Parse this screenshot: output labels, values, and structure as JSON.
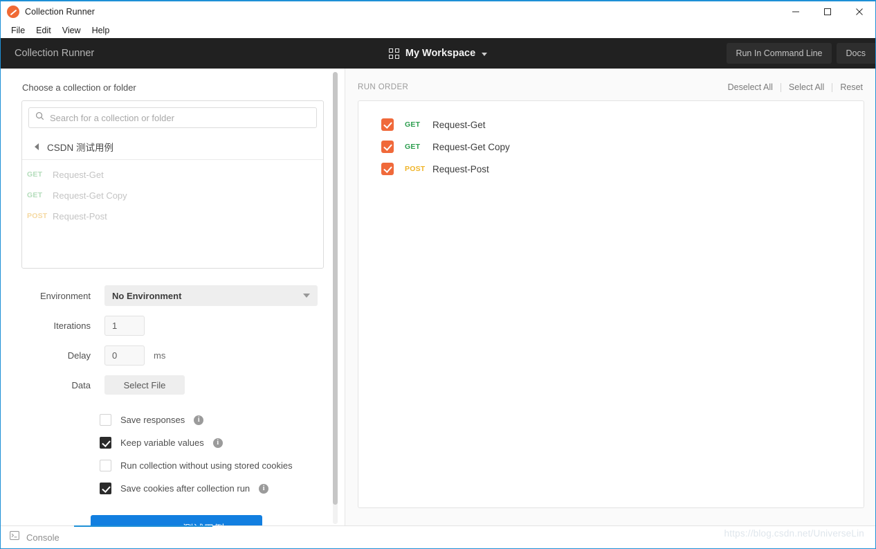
{
  "window": {
    "title": "Collection Runner",
    "logo_icon": "postman-logo-icon",
    "controls": {
      "minimize": "minimize-icon",
      "maximize": "maximize-icon",
      "close": "close-icon"
    }
  },
  "menubar": {
    "items": [
      {
        "label": "File"
      },
      {
        "label": "Edit"
      },
      {
        "label": "View"
      },
      {
        "label": "Help"
      }
    ]
  },
  "header": {
    "title": "Collection Runner",
    "workspace": {
      "icon": "grid-icon",
      "name": "My Workspace",
      "chevron": "chevron-down-icon"
    },
    "run_command_line_label": "Run In Command Line",
    "docs_label": "Docs",
    "background": "#212121"
  },
  "left": {
    "choose_label": "Choose a collection or folder",
    "search": {
      "icon": "search-icon",
      "placeholder": "Search for a collection or folder",
      "value": ""
    },
    "breadcrumb": {
      "back_icon": "back-triangle-icon",
      "name": "CSDN 测试用例"
    },
    "requests": [
      {
        "method": "GET",
        "name": "Request-Get"
      },
      {
        "method": "GET",
        "name": "Request-Get Copy"
      },
      {
        "method": "POST",
        "name": "Request-Post"
      }
    ],
    "form": {
      "environment_label": "Environment",
      "environment_value": "No Environment",
      "iterations_label": "Iterations",
      "iterations_value": "1",
      "delay_label": "Delay",
      "delay_value": "0",
      "delay_unit": "ms",
      "data_label": "Data",
      "select_file_label": "Select File"
    },
    "options": [
      {
        "label": "Save responses",
        "checked": false,
        "info": true
      },
      {
        "label": "Keep variable values",
        "checked": true,
        "info": true
      },
      {
        "label": "Run collection without using stored cookies",
        "checked": false,
        "info": false
      },
      {
        "label": "Save cookies after collection run",
        "checked": true,
        "info": true
      }
    ],
    "run_button_label": "Run CSDN 测试用例",
    "run_button_color": "#127fe0"
  },
  "right": {
    "section_title": "RUN ORDER",
    "deselect_all_label": "Deselect All",
    "select_all_label": "Select All",
    "reset_label": "Reset",
    "items": [
      {
        "method": "GET",
        "name": "Request-Get",
        "checked": true
      },
      {
        "method": "GET",
        "name": "Request-Get Copy",
        "checked": true
      },
      {
        "method": "POST",
        "name": "Request-Post",
        "checked": true
      }
    ],
    "checkbox_color": "#f0693a"
  },
  "footer": {
    "console_icon": "console-icon",
    "console_label": "Console",
    "watermark": "https://blog.csdn.net/UniverseLin"
  }
}
